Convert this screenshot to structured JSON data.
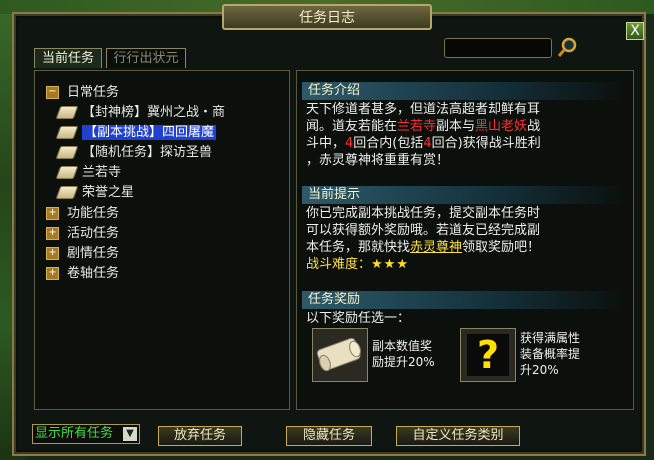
{
  "window": {
    "title": "任务日志"
  },
  "close_label": "X",
  "tabs": [
    {
      "label": "当前任务"
    },
    {
      "label": "行行出状元"
    }
  ],
  "tree": {
    "daily": {
      "toggle": "−",
      "label": "日常任务"
    },
    "daily_items": [
      {
        "label": "【封神榜】冀州之战・商"
      },
      {
        "label": "【副本挑战】四回屠魔"
      },
      {
        "label": "【随机任务】探访圣兽"
      },
      {
        "label": "兰若寺"
      },
      {
        "label": "荣誉之星"
      }
    ],
    "groups": [
      {
        "toggle": "+",
        "label": "功能任务"
      },
      {
        "toggle": "+",
        "label": "活动任务"
      },
      {
        "toggle": "+",
        "label": "剧情任务"
      },
      {
        "toggle": "+",
        "label": "卷轴任务"
      }
    ]
  },
  "intro": {
    "heading": "任务介绍",
    "line1": "天下修道者甚多，但道法高超者却鲜有耳",
    "line2a": "闻。道友若能在",
    "place": "兰若寺",
    "line2b": "副本与",
    "boss": "黑山老妖",
    "line2c": "战",
    "line3a": "斗中，",
    "n1": "4",
    "line3b": "回合内(包括",
    "n2": "4",
    "line3c": "回合)获得战斗胜利",
    "line4": "，赤灵尊神将重重有赏！"
  },
  "hint": {
    "heading": "当前提示",
    "line1": "你已完成副本挑战任务，提交副本任务时",
    "line2": "可以获得额外奖励哦。若道友已经完成副",
    "line3a": "本任务，那就快找",
    "npc": "赤灵尊神",
    "line3b": "领取奖励吧！",
    "difficulty_label": "战斗难度：",
    "stars": "★★★"
  },
  "reward": {
    "heading": "任务奖励",
    "choose": "以下奖励任选一：",
    "items": [
      {
        "line1": "副本数值奖",
        "line2": "励提升20%"
      },
      {
        "icon": "?",
        "line1": "获得满属性",
        "line2": "装备概率提",
        "line3": "升20%"
      }
    ]
  },
  "bottom": {
    "filter": "显示所有任务",
    "abandon": "放弃任务",
    "hide": "隐藏任务",
    "custom": "自定义任务类别"
  }
}
